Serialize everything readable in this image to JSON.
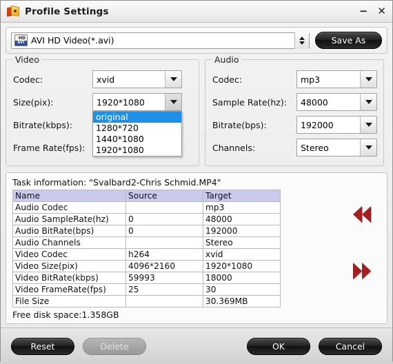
{
  "window": {
    "title": "Profile Settings",
    "app_icon": "profile-settings-icon",
    "minimize_label": "−",
    "close_label": "✕"
  },
  "profile": {
    "format_icon": "avi-hd-format-icon",
    "icon_hd_label": "HD",
    "icon_avi_label": "AVI",
    "selected": "AVI HD Video(*.avi)",
    "save_as_label": "Save As"
  },
  "video": {
    "group_title": "Video",
    "rows": [
      {
        "label": "Codec:",
        "value": "xvid"
      },
      {
        "label": "Size(pix):",
        "value": "1920*1080"
      },
      {
        "label": "Bitrate(kbps):",
        "value": "18000"
      },
      {
        "label": "Frame Rate(fps):",
        "value": "30"
      }
    ],
    "size_dropdown": {
      "open": true,
      "options": [
        "original",
        "1280*720",
        "1440*1080",
        "1920*1080"
      ],
      "highlighted": "original"
    }
  },
  "audio": {
    "group_title": "Audio",
    "rows": [
      {
        "label": "Codec:",
        "value": "mp3"
      },
      {
        "label": "Sample Rate(hz):",
        "value": "48000"
      },
      {
        "label": "Bitrate(bps):",
        "value": "192000"
      },
      {
        "label": "Channels:",
        "value": "Stereo"
      }
    ]
  },
  "task": {
    "title": "Task information: \"Svalbard2-Chris Schmid.MP4\"",
    "columns": [
      "Name",
      "Source",
      "Target"
    ],
    "rows": [
      {
        "name": "Audio Codec",
        "source": "",
        "target": "mp3"
      },
      {
        "name": "Audio SampleRate(hz)",
        "source": "0",
        "target": "48000"
      },
      {
        "name": "Audio BitRate(bps)",
        "source": "0",
        "target": "192000"
      },
      {
        "name": "Audio Channels",
        "source": "",
        "target": "Stereo"
      },
      {
        "name": "Video Codec",
        "source": "h264",
        "target": "xvid"
      },
      {
        "name": "Video Size(pix)",
        "source": "4096*2160",
        "target": "1920*1080"
      },
      {
        "name": "Video BitRate(kbps)",
        "source": "59993",
        "target": "18000"
      },
      {
        "name": "Video FrameRate(fps)",
        "source": "25",
        "target": "30"
      },
      {
        "name": "File Size",
        "source": "",
        "target": "30.369MB"
      }
    ],
    "disk_space": "Free disk space:1.358GB",
    "prev_icon": "double-arrow-left-icon",
    "next_icon": "double-arrow-right-icon"
  },
  "footer": {
    "reset_label": "Reset",
    "delete_label": "Delete",
    "ok_label": "OK",
    "cancel_label": "Cancel"
  },
  "colors": {
    "table_header": "#c9caee",
    "dropdown_highlight": "#1e90e8",
    "nav_arrow": "#a31f1f"
  }
}
